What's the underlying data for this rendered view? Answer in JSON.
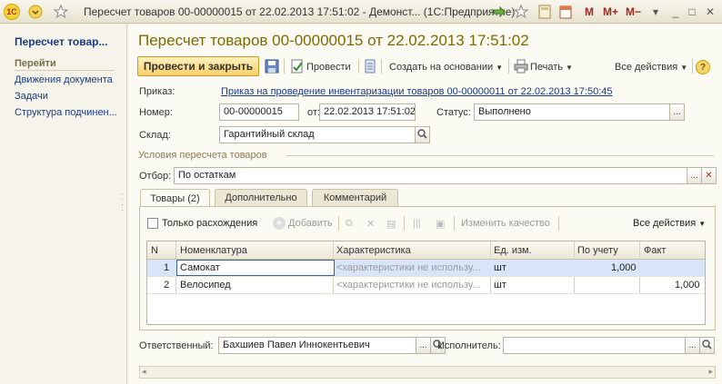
{
  "window": {
    "title": "Пересчет товаров 00-00000015 от 22.02.2013 17:51:02 - Демонст...  (1С:Предприятие)",
    "logo": "1С",
    "m": "M",
    "mplus": "M+",
    "mminus": "M−"
  },
  "sidebar": {
    "title": "Пересчет товар...",
    "section": "Перейти",
    "items": [
      "Движения документа",
      "Задачи",
      "Структура подчинен..."
    ]
  },
  "form": {
    "title": "Пересчет товаров 00-00000015 от 22.02.2013 17:51:02",
    "toolbar": {
      "post_close": "Провести и закрыть",
      "post": "Провести",
      "create_based": "Создать на основании",
      "print": "Печать",
      "all_actions": "Все действия",
      "help": "?"
    },
    "order_label": "Приказ:",
    "order_link": "Приказ на проведение инвентаризации товаров 00-00000011 от 22.02.2013 17:50:45",
    "number_label": "Номер:",
    "number_value": "00-00000015",
    "date_label": "от:",
    "date_value": "22.02.2013 17:51:02",
    "status_label": "Статус:",
    "status_value": "Выполнено",
    "warehouse_label": "Склад:",
    "warehouse_value": "Гарантийный склад",
    "conditions_title": "Условия пересчета товаров",
    "filter_label": "Отбор:",
    "filter_value": "По остаткам",
    "tabs": [
      "Товары (2)",
      "Дополнительно",
      "Комментарий"
    ],
    "panel": {
      "only_diff": "Только расхождения",
      "add": "Добавить",
      "change_quality": "Изменить качество",
      "all_actions": "Все действия"
    },
    "table": {
      "headers": [
        "N",
        "Номенклатура",
        "Характеристика",
        "Ед. изм.",
        "По учету",
        "Факт"
      ],
      "rows": [
        {
          "n": "1",
          "name": "Самокат",
          "char": "<характеристики не использу...",
          "unit": "шт",
          "book": "1,000",
          "fact": ""
        },
        {
          "n": "2",
          "name": "Велосипед",
          "char": "<характеристики не использу...",
          "unit": "шт",
          "book": "",
          "fact": "1,000"
        }
      ]
    },
    "responsible_label": "Ответственный:",
    "responsible_value": "Бахшиев Павел Иннокентьевич",
    "executor_label": "Исполнитель:",
    "executor_value": ""
  }
}
